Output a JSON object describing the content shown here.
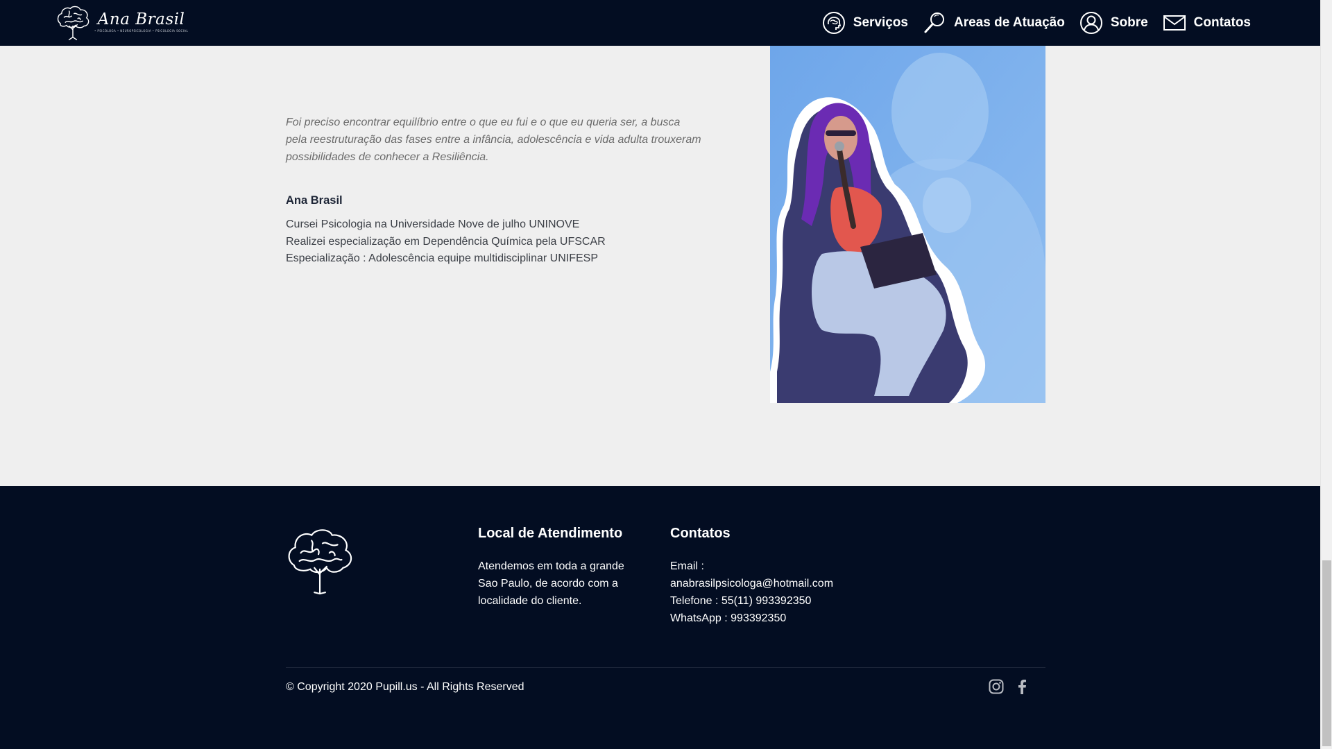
{
  "nav": {
    "logo_name": "Ana Brasil",
    "logo_tagline": "• PSICÓLOGA • NEUROPSICOLOGIA • PSICOLOGIA SOCIAL",
    "items": [
      {
        "label": "Serviços",
        "icon": "head-brain-icon"
      },
      {
        "label": "Areas de Atuação",
        "icon": "magnifier-icon"
      },
      {
        "label": "Sobre",
        "icon": "user-circle-icon"
      },
      {
        "label": "Contatos",
        "icon": "envelope-icon"
      }
    ]
  },
  "about": {
    "quote_lines": [
      "Foi preciso encontrar equilíbrio entre o que eu fui e o que eu queria ser, a busca",
      "pela reestruturação das fases entre a infância, adolescência e vida adulta trouxeram",
      "possibilidades de conhecer a Resiliência."
    ],
    "name": "Ana Brasil",
    "bio_lines": [
      "Cursei Psicologia na Universidade Nove de julho UNINOVE",
      "Realizei especialização em Dependência Química pela UFSCAR",
      "Especialização : Adolescência equipe multidisciplinar UNIFESP"
    ]
  },
  "footer": {
    "location": {
      "title": "Local de Atendimento",
      "lines": [
        "Atendemos em toda a grande",
        "Sao Paulo, de acordo com a",
        "localidade do cliente."
      ]
    },
    "contacts": {
      "title": "Contatos",
      "lines": [
        "Email :",
        "anabrasilpsicologa@hotmail.com",
        "Telefone : 55(11) 993392350",
        "WhatsApp : 993392350"
      ]
    },
    "copyright": "© Copyright 2020 Pupill.us - All Rights Reserved",
    "social": [
      "instagram-icon",
      "facebook-icon"
    ]
  },
  "colors": {
    "navy": "#030d22",
    "page_bg": "#efefef",
    "photo_blue": "#7fb1ea"
  }
}
